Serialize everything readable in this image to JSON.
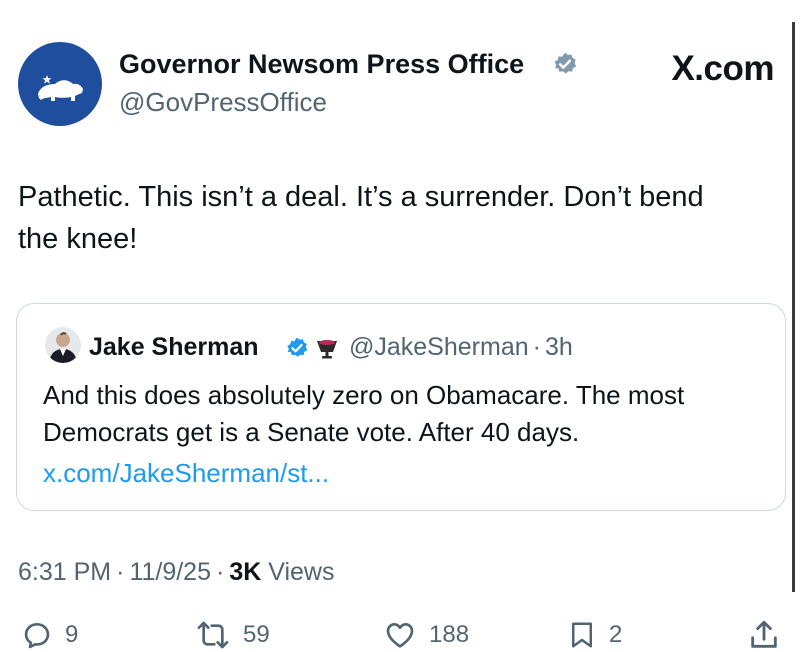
{
  "author": {
    "name": "Governor Newsom Press Office",
    "handle": "@GovPressOffice",
    "avatar_icon": "california-bear-icon",
    "verified_icon": "verified-badge-gray-icon"
  },
  "brand": "X.com",
  "post": {
    "text": "Pathetic. This isn’t a deal. It’s a surrender. Don’t bend the knee!"
  },
  "quoted": {
    "name": "Jake Sherman",
    "handle": "@JakeSherman",
    "time": "3h",
    "separator": "·",
    "text": "And this does absolutely zero on Obamacare. The most Democrats get is a Senate vote. After 40 days.",
    "link": "x.com/JakeSherman/st..."
  },
  "meta": {
    "time": "6:31 PM",
    "date": "11/9/25",
    "views_count": "3K",
    "views_label": "Views",
    "separator": "·"
  },
  "actions": {
    "replies": "9",
    "reposts": "59",
    "likes": "188",
    "bookmarks": "2"
  },
  "colors": {
    "text": "#0f1419",
    "secondary": "#536471",
    "link": "#1d9bf0",
    "avatar_bg": "#1f4e9e",
    "border": "#cfd9de"
  }
}
